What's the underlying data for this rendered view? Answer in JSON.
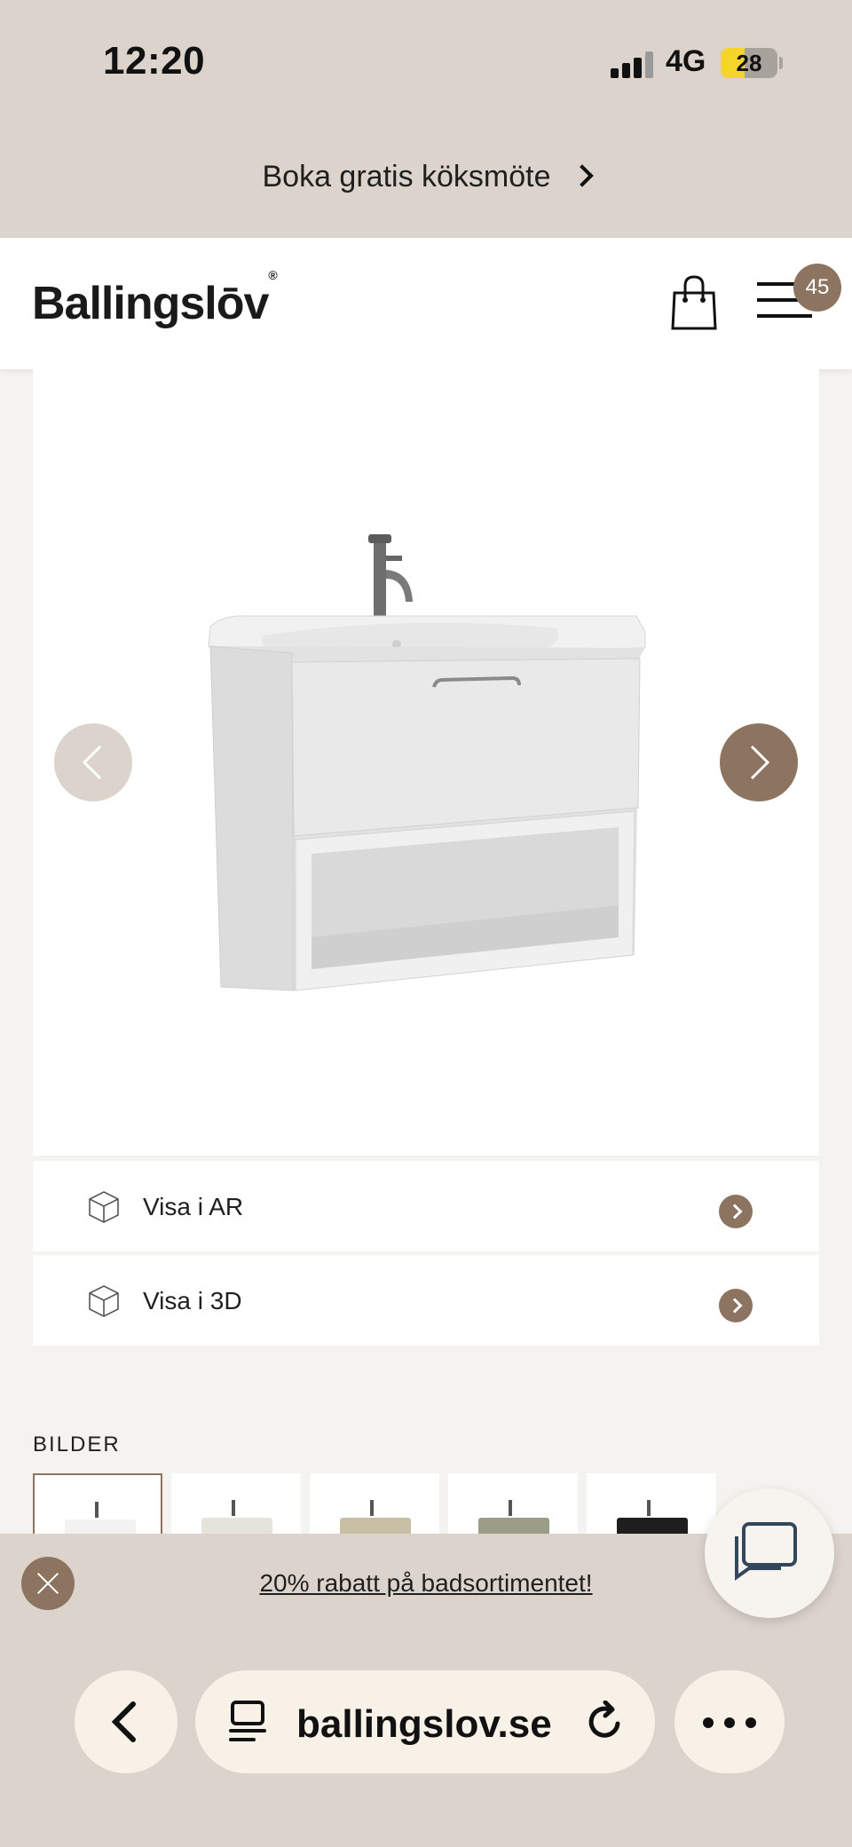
{
  "status_bar": {
    "time": "12:20",
    "network": "4G",
    "battery": "28"
  },
  "promo_top": {
    "text": "Boka gratis köksmöte"
  },
  "header": {
    "logo": "Ballingslōv",
    "logo_mark": "®",
    "menu_badge": "45"
  },
  "product_actions": [
    {
      "label": "Visa i AR"
    },
    {
      "label": "Visa i 3D"
    }
  ],
  "gallery": {
    "heading": "BILDER",
    "thumbnails": [
      {
        "color": "#f2f2f2"
      },
      {
        "color": "#e6e3da"
      },
      {
        "color": "#c9bfa5"
      },
      {
        "color": "#9c9d87"
      },
      {
        "color": "#1e1e1e"
      }
    ]
  },
  "promo_bottom": {
    "text": "20% rabatt på badsortimentet!"
  },
  "browser": {
    "url": "ballingslov.se"
  },
  "colors": {
    "accent": "#8c7460",
    "beige": "#dcd4cc"
  }
}
